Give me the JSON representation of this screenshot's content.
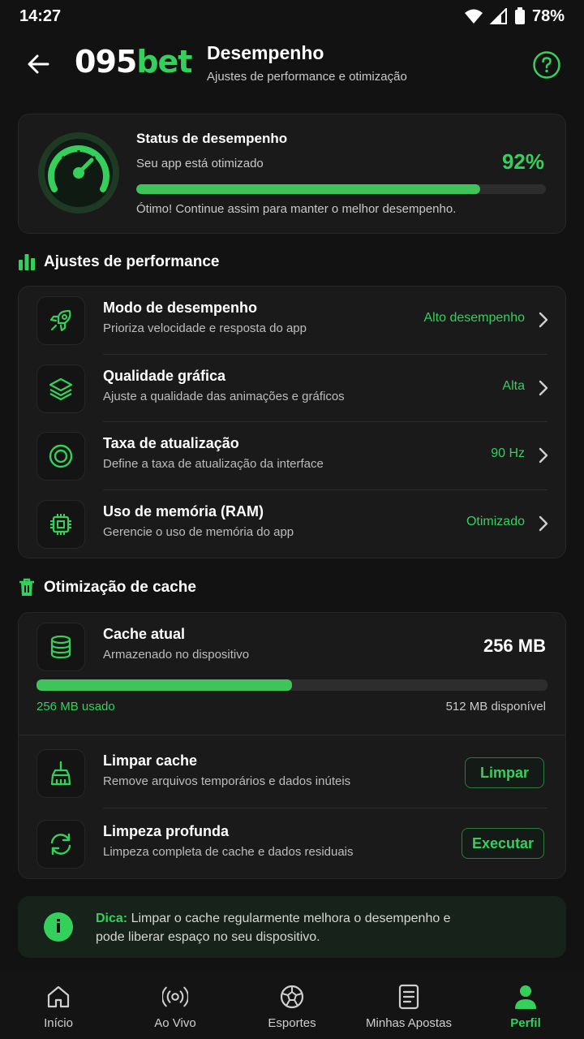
{
  "status_bar": {
    "time": "14:27",
    "battery": "78%"
  },
  "header": {
    "logo_main": "095",
    "logo_accent": "bet",
    "title": "Desempenho",
    "subtitle": "Ajustes de performance e otimização"
  },
  "status_card": {
    "title": "Status de desempenho",
    "subtitle": "Seu app está otimizado",
    "percent_label": "92%",
    "progress": 0.84,
    "note": "Ótimo! Continue assim para manter o melhor desempenho."
  },
  "performance_section": {
    "title": "Ajustes de performance",
    "items": [
      {
        "title": "Modo de desempenho",
        "subtitle": "Prioriza velocidade e resposta do app",
        "value": "Alto desempenho",
        "icon": "rocket-icon"
      },
      {
        "title": "Qualidade gráfica",
        "subtitle": "Ajuste a qualidade das animações e gráficos",
        "value": "Alta",
        "icon": "layers-icon"
      },
      {
        "title": "Taxa de atualização",
        "subtitle": "Define a taxa de atualização da interface",
        "value": "90 Hz",
        "icon": "target-icon"
      },
      {
        "title": "Uso de memória (RAM)",
        "subtitle": "Gerencie o uso de memória do app",
        "value": "Otimizado",
        "icon": "chip-icon"
      }
    ]
  },
  "cache_section": {
    "title": "Otimização de cache",
    "current": {
      "title": "Cache atual",
      "subtitle": "Armazenado no dispositivo",
      "size": "256 MB",
      "progress": 0.5,
      "used_label": "256 MB usado",
      "available_label": "512 MB disponível"
    },
    "actions": [
      {
        "title": "Limpar cache",
        "subtitle": "Remove arquivos temporários e dados inúteis",
        "button": "Limpar",
        "icon": "broom-icon"
      },
      {
        "title": "Limpeza profunda",
        "subtitle": "Limpeza completa de cache e dados residuais",
        "button": "Executar",
        "icon": "refresh-icon"
      }
    ]
  },
  "tip": {
    "label": "Dica:",
    "text": " Limpar o cache regularmente melhora o desempenho e pode liberar espaço no seu dispositivo."
  },
  "bottom_nav": {
    "items": [
      {
        "label": "Início",
        "icon": "home-icon"
      },
      {
        "label": "Ao Vivo",
        "icon": "live-icon"
      },
      {
        "label": "Esportes",
        "icon": "ball-icon"
      },
      {
        "label": "Minhas Apostas",
        "icon": "ticket-icon"
      },
      {
        "label": "Perfil",
        "icon": "user-icon"
      }
    ],
    "active": "Perfil"
  },
  "colors": {
    "accent": "#35d05c",
    "background": "#121212",
    "card": "#1a1a1a"
  }
}
